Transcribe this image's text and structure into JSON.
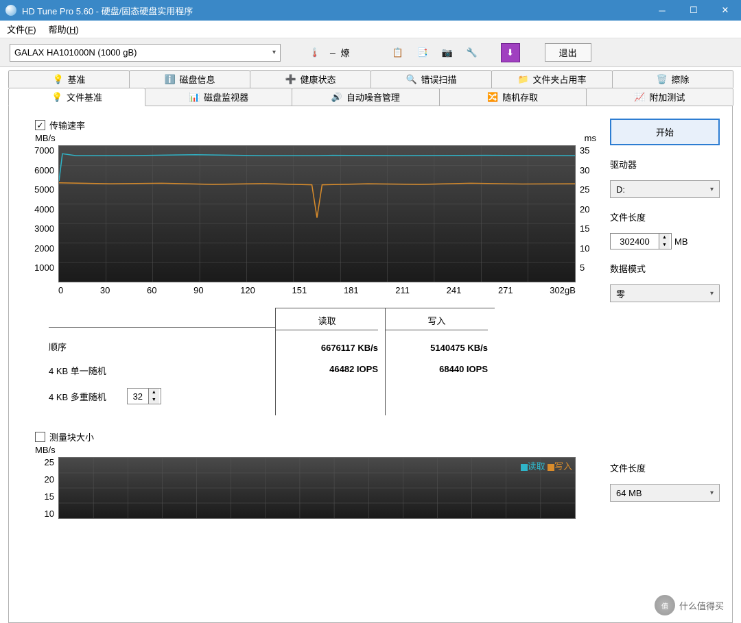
{
  "window": {
    "title": "HD Tune Pro 5.60 - 硬盘/固态硬盘实用程序"
  },
  "menu": {
    "file": "文件(F)",
    "help": "帮助(H)"
  },
  "toolbar": {
    "device": "GALAX HA101000N (1000 gB)",
    "exit": "退出"
  },
  "tabs_top": [
    {
      "label": "基准",
      "icon": "bulb"
    },
    {
      "label": "磁盘信息",
      "icon": "info"
    },
    {
      "label": "健康状态",
      "icon": "plus"
    },
    {
      "label": "错误扫描",
      "icon": "search"
    },
    {
      "label": "文件夹占用率",
      "icon": "folder"
    },
    {
      "label": "擦除",
      "icon": "trash"
    }
  ],
  "tabs_bottom": [
    {
      "label": "文件基准",
      "icon": "bulb2",
      "active": true
    },
    {
      "label": "磁盘监视器",
      "icon": "chart"
    },
    {
      "label": "自动噪音管理",
      "icon": "speaker"
    },
    {
      "label": "随机存取",
      "icon": "random"
    },
    {
      "label": "附加测试",
      "icon": "extra"
    }
  ],
  "panel": {
    "transfer_rate": "传输速率",
    "block_size": "测量块大小",
    "start": "开始",
    "drive_label": "驱动器",
    "drive_value": "D:",
    "file_len_label": "文件长度",
    "file_len_value": "302400",
    "file_len_unit": "MB",
    "data_mode_label": "数据模式",
    "data_mode_value": "零",
    "file_len2_label": "文件长度",
    "file_len2_value": "64 MB"
  },
  "table": {
    "read": "读取",
    "write": "写入",
    "rows": [
      {
        "label": "顺序",
        "read": "6676117 KB/s",
        "write": "5140475 KB/s"
      },
      {
        "label": "4 KB 单一随机",
        "read": "46482 IOPS",
        "write": "68440 IOPS"
      },
      {
        "label": "4 KB 多重随机",
        "read": "",
        "write": "",
        "spin": "32"
      }
    ]
  },
  "chart_data": {
    "type": "line",
    "title": "",
    "xlabel": "gB",
    "ylabel_left": "MB/s",
    "ylabel_right": "ms",
    "ylim_left": [
      0,
      7000
    ],
    "ylim_right": [
      0,
      35
    ],
    "xlim": [
      0,
      302
    ],
    "xticks": [
      "0",
      "30",
      "60",
      "90",
      "120",
      "151",
      "181",
      "211",
      "241",
      "271",
      "302gB"
    ],
    "yticks_left": [
      "7000",
      "6000",
      "5000",
      "4000",
      "3000",
      "2000",
      "1000",
      ""
    ],
    "yticks_right": [
      "35",
      "30",
      "25",
      "20",
      "15",
      "10",
      "5",
      ""
    ],
    "series": [
      {
        "name": "读取",
        "color": "#2fb5c9",
        "data": [
          [
            0,
            5200
          ],
          [
            2,
            6600
          ],
          [
            10,
            6500
          ],
          [
            40,
            6500
          ],
          [
            80,
            6550
          ],
          [
            120,
            6500
          ],
          [
            151,
            6500
          ],
          [
            160,
            6520
          ],
          [
            200,
            6500
          ],
          [
            250,
            6520
          ],
          [
            302,
            6500
          ]
        ]
      },
      {
        "name": "写入",
        "color": "#d98c2b",
        "data": [
          [
            0,
            5100
          ],
          [
            30,
            5050
          ],
          [
            60,
            5080
          ],
          [
            90,
            5020
          ],
          [
            120,
            5060
          ],
          [
            148,
            5000
          ],
          [
            151,
            3300
          ],
          [
            154,
            5000
          ],
          [
            181,
            5050
          ],
          [
            211,
            5020
          ],
          [
            241,
            5080
          ],
          [
            271,
            5040
          ],
          [
            302,
            5050
          ]
        ]
      }
    ]
  },
  "chart2_data": {
    "type": "line",
    "ylabel_left": "MB/s",
    "yticks_left": [
      "25",
      "20",
      "15",
      "10"
    ],
    "legend": [
      {
        "name": "读取",
        "color": "#2fb5c9"
      },
      {
        "name": "写入",
        "color": "#d98c2b"
      }
    ]
  },
  "watermark": "什么值得买"
}
